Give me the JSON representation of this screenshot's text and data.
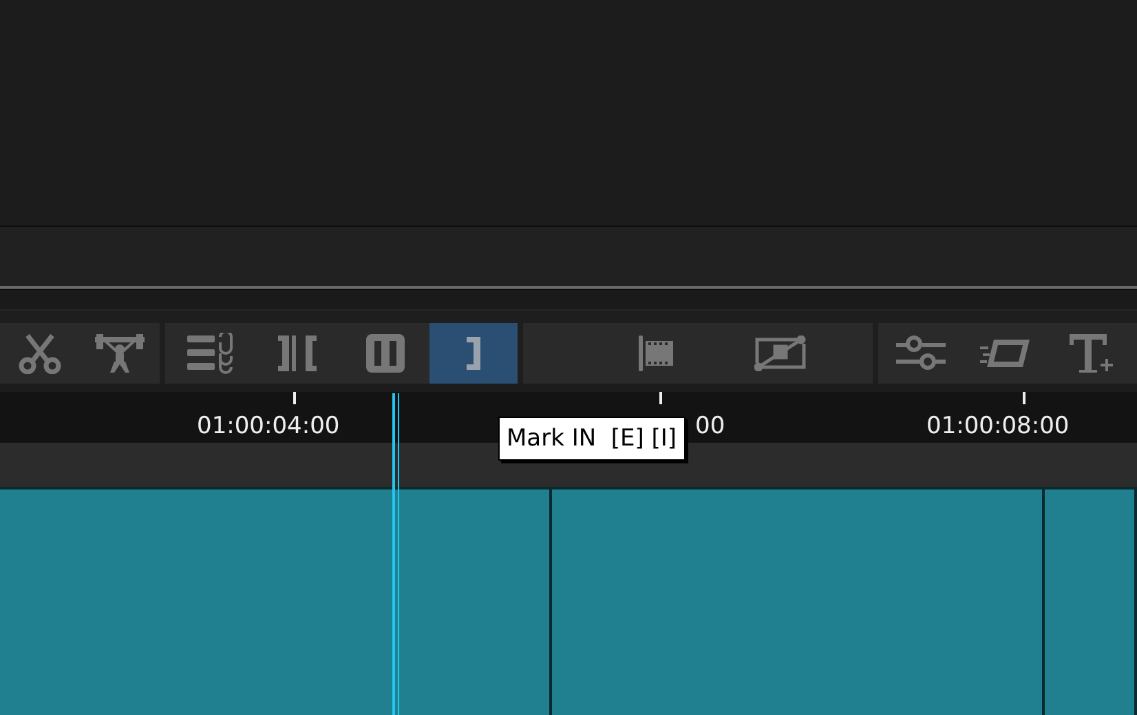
{
  "toolbar": {
    "groups": [
      {
        "tools": [
          {
            "kind": "scissors",
            "selected": false
          },
          {
            "kind": "lifter",
            "selected": false
          }
        ]
      },
      {
        "tools": [
          {
            "kind": "link",
            "selected": false
          },
          {
            "kind": "ripple",
            "selected": false
          },
          {
            "kind": "split",
            "selected": false
          },
          {
            "kind": "markin",
            "selected": true
          }
        ]
      },
      {
        "tools": [
          {
            "kind": "filmedge",
            "selected": false
          },
          {
            "kind": "keyframe",
            "selected": false
          }
        ]
      },
      {
        "tools": [
          {
            "kind": "sliders",
            "selected": false
          },
          {
            "kind": "film",
            "selected": false
          },
          {
            "kind": "text",
            "selected": false
          }
        ]
      }
    ]
  },
  "ruler": {
    "labels": [
      {
        "text": "01:00:04:00"
      },
      {
        "text": "00"
      },
      {
        "text": "01:00:08:00"
      }
    ]
  },
  "tooltip": {
    "text": "Mark IN  [E] [I]"
  }
}
